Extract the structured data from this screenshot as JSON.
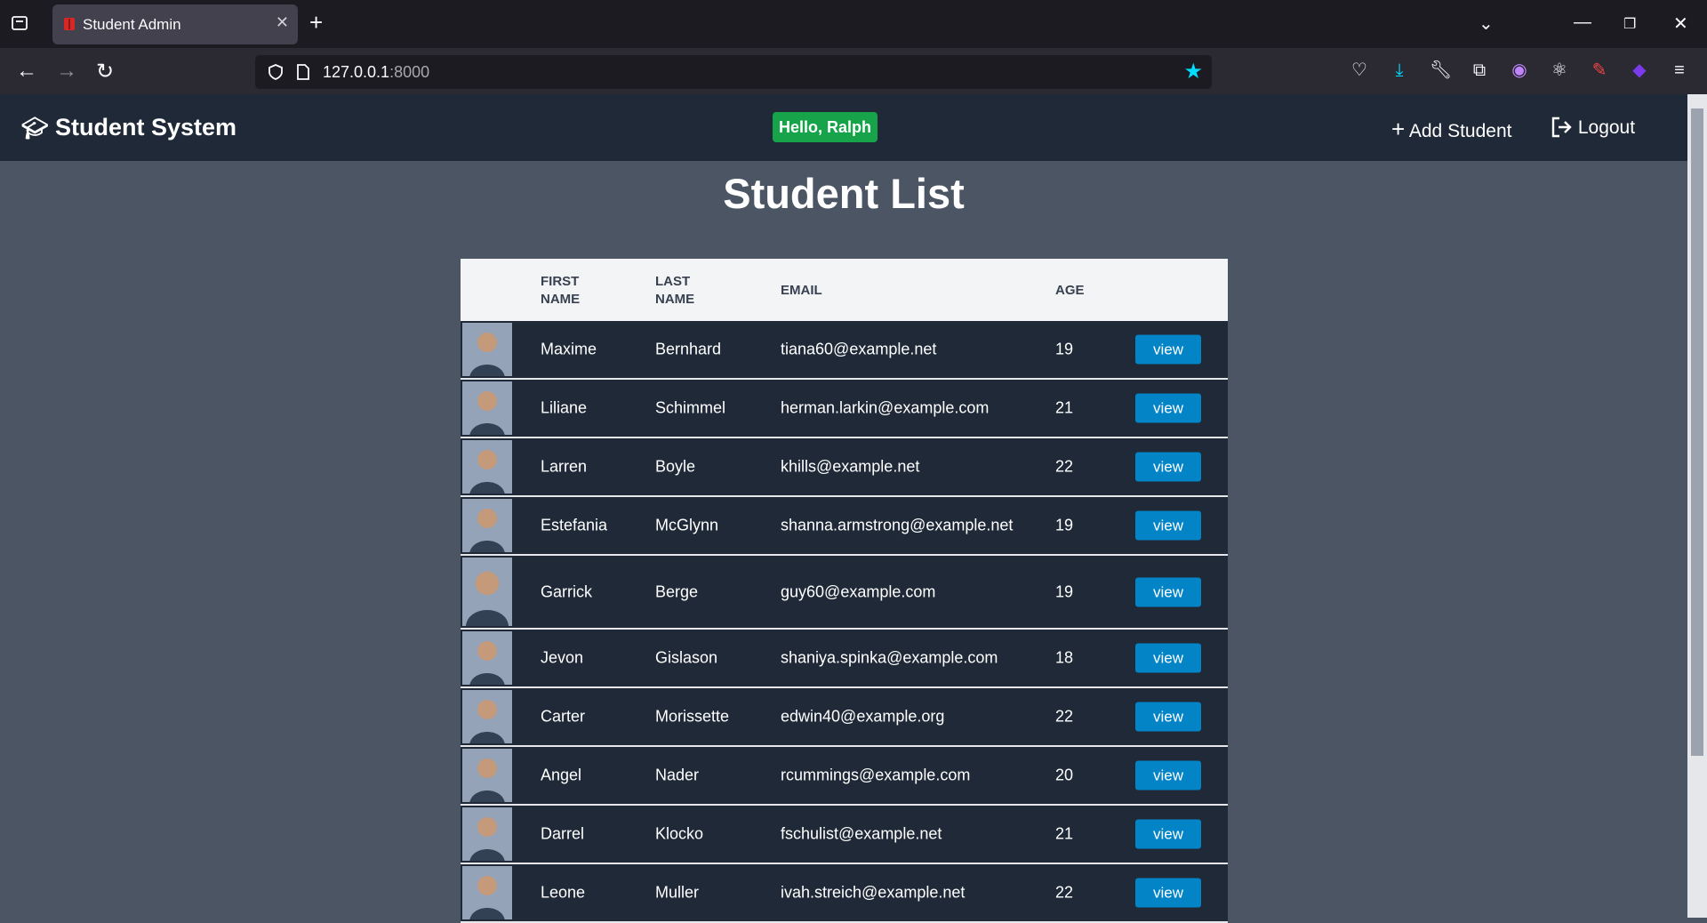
{
  "browser": {
    "tab_title": "Student Admin",
    "url_host": "127.0.0.1",
    "url_port": ":8000"
  },
  "header": {
    "brand": "Student System",
    "greeting": "Hello, Ralph",
    "add_student": "Add Student",
    "logout": "Logout"
  },
  "page": {
    "title": "Student List"
  },
  "table": {
    "columns": [
      "FIRST NAME",
      "LAST NAME",
      "EMAIL",
      "AGE"
    ],
    "view_label": "view",
    "rows": [
      {
        "first": "Maxime",
        "last": "Bernhard",
        "email": "tiana60@example.net",
        "age": "19"
      },
      {
        "first": "Liliane",
        "last": "Schimmel",
        "email": "herman.larkin@example.com",
        "age": "21"
      },
      {
        "first": "Larren",
        "last": "Boyle",
        "email": "khills@example.net",
        "age": "22"
      },
      {
        "first": "Estefania",
        "last": "McGlynn",
        "email": "shanna.armstrong@example.net",
        "age": "19"
      },
      {
        "first": "Garrick",
        "last": "Berge",
        "email": "guy60@example.com",
        "age": "19"
      },
      {
        "first": "Jevon",
        "last": "Gislason",
        "email": "shaniya.spinka@example.com",
        "age": "18"
      },
      {
        "first": "Carter",
        "last": "Morissette",
        "email": "edwin40@example.org",
        "age": "22"
      },
      {
        "first": "Angel",
        "last": "Nader",
        "email": "rcummings@example.com",
        "age": "20"
      },
      {
        "first": "Darrel",
        "last": "Klocko",
        "email": "fschulist@example.net",
        "age": "21"
      },
      {
        "first": "Leone",
        "last": "Muller",
        "email": "ivah.streich@example.net",
        "age": "22"
      }
    ]
  }
}
